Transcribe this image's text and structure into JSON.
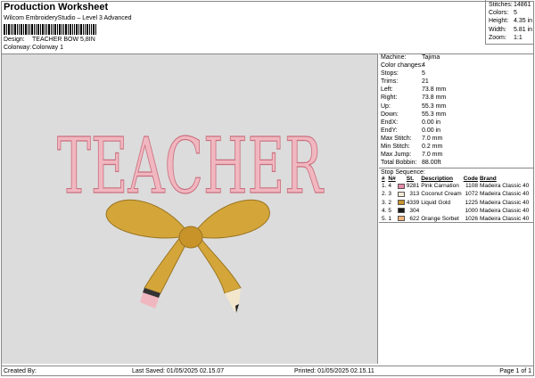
{
  "header": {
    "title": "Production Worksheet",
    "software": "Wilcom EmbroideryStudio – Level 3 Advanced",
    "design_label": "Design:",
    "design": "TEACHER BOW 5,8IN",
    "colorway_label": "Colorway:",
    "colorway": "Colorway 1"
  },
  "stats": [
    {
      "label": "Stitches:",
      "value": "14861"
    },
    {
      "label": "Colors:",
      "value": "5"
    },
    {
      "label": "Height:",
      "value": "4.35 in"
    },
    {
      "label": "Width:",
      "value": "5.81 in"
    },
    {
      "label": "Zoom:",
      "value": "1:1"
    }
  ],
  "design_text": "TEACHER",
  "details": [
    {
      "label": "Machine:",
      "value": "Tajima"
    },
    {
      "label": "Color changes:",
      "value": "4"
    },
    {
      "label": "Stops:",
      "value": "5"
    },
    {
      "label": "Trims:",
      "value": "21"
    },
    {
      "label": "Left:",
      "value": "73.8 mm"
    },
    {
      "label": "Right:",
      "value": "73.8 mm"
    },
    {
      "label": "Up:",
      "value": "55.3 mm"
    },
    {
      "label": "Down:",
      "value": "55.3 mm"
    },
    {
      "label": "EndX:",
      "value": "0.00 in"
    },
    {
      "label": "EndY:",
      "value": "0.00 in"
    },
    {
      "label": "Max Stitch:",
      "value": "7.0 mm"
    },
    {
      "label": "Min Stitch:",
      "value": "0.2 mm"
    },
    {
      "label": "Max Jump:",
      "value": "7.0 mm"
    },
    {
      "label": "Total Bobbin:",
      "value": "88.00ft"
    }
  ],
  "stop_sequence": {
    "title": "Stop Sequence:",
    "headers": [
      "#",
      "N#",
      "",
      "St.",
      "Description",
      "Code",
      "Brand"
    ],
    "rows": [
      {
        "num": "1.",
        "n": "4",
        "color": "#e88aa8",
        "st": "9281",
        "desc": "Pink Carnation",
        "code": "1108",
        "brand": "Madeira Classic 40"
      },
      {
        "num": "2.",
        "n": "3",
        "color": "#f3ead6",
        "st": "313",
        "desc": "Coconut Cream",
        "code": "1072",
        "brand": "Madeira Classic 40"
      },
      {
        "num": "3.",
        "n": "2",
        "color": "#c8942a",
        "st": "4339",
        "desc": "Liquid Gold",
        "code": "1225",
        "brand": "Madeira Classic 40"
      },
      {
        "num": "4.",
        "n": "5",
        "color": "#1a1a1a",
        "st": "304",
        "desc": "",
        "code": "1000",
        "brand": "Madeira Classic 40"
      },
      {
        "num": "5.",
        "n": "1",
        "color": "#f4b47a",
        "st": "622",
        "desc": "Orange Sorbet",
        "code": "1026",
        "brand": "Madeira Classic 40"
      }
    ]
  },
  "footer": {
    "created": "Created By:",
    "saved": "Last Saved: 01/05/2025 02.15.07",
    "printed": "Printed: 01/05/2025 02.15.11",
    "page": "Page 1 of 1"
  }
}
